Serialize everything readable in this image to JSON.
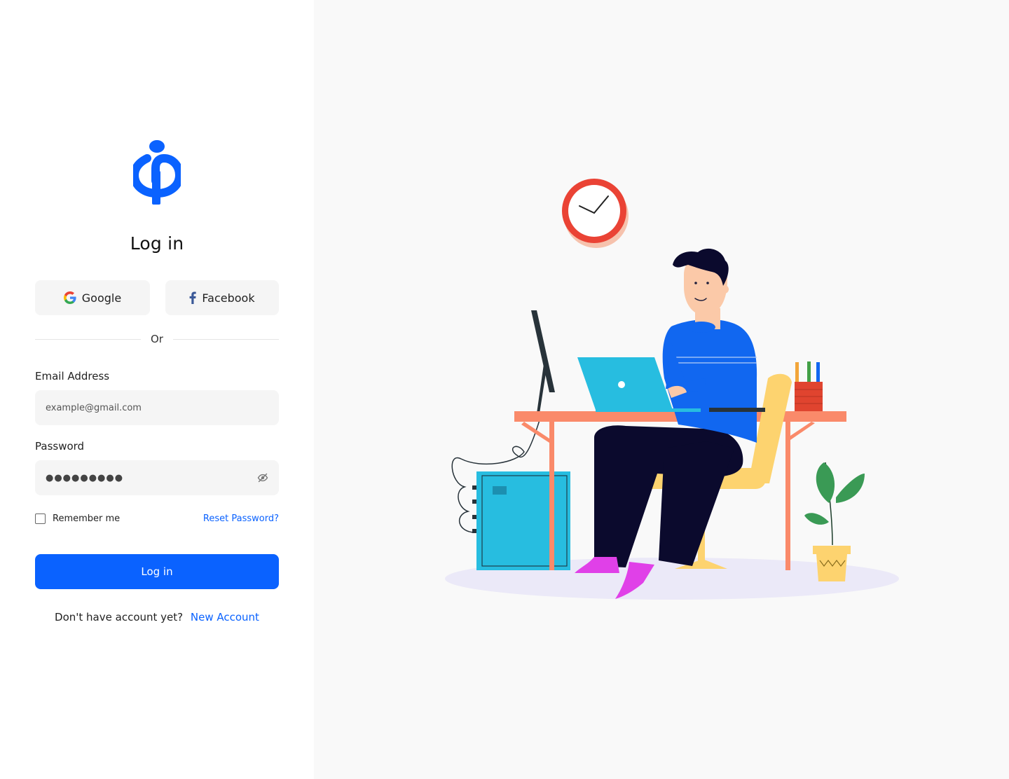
{
  "auth": {
    "title": "Log in",
    "social": {
      "google_label": "Google",
      "facebook_label": "Facebook"
    },
    "divider_text": "Or",
    "email": {
      "label": "Email Address",
      "placeholder": "example@gmail.com",
      "value": ""
    },
    "password": {
      "label": "Password",
      "masked_value": "●●●●●●●●●"
    },
    "remember_label": "Remember me",
    "remember_checked": false,
    "reset_label": "Reset Password?",
    "submit_label": "Log in",
    "signup_prompt": "Don't have account yet?",
    "signup_link": "New Account"
  },
  "colors": {
    "brand": "#0a62ff",
    "input_bg": "#f5f5f5",
    "panel_bg": "#f9f9f9"
  },
  "icons": {
    "logo": "phi-logo",
    "google": "google-icon",
    "facebook": "facebook-icon",
    "password_toggle": "eye-off-icon"
  }
}
